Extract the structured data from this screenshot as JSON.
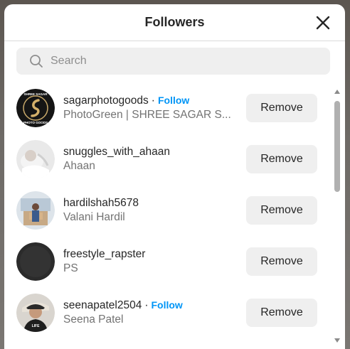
{
  "modal": {
    "title": "Followers"
  },
  "search": {
    "placeholder": "Search"
  },
  "followers": [
    {
      "username": "sagarphotogoods",
      "separator": "·",
      "follow_label": "Follow",
      "full_name": "PhotoGreen | SHREE SAGAR S...",
      "remove_label": "Remove",
      "avatar_text": "SHREE SAGAR PHOTO GOODS"
    },
    {
      "username": "snuggles_with_ahaan",
      "full_name": "Ahaan",
      "remove_label": "Remove"
    },
    {
      "username": "hardilshah5678",
      "full_name": "Valani Hardil",
      "remove_label": "Remove"
    },
    {
      "username": "freestyle_rapster",
      "full_name": "PS",
      "remove_label": "Remove"
    },
    {
      "username": "seenapatel2504",
      "separator": "·",
      "follow_label": "Follow",
      "full_name": "Seena Patel",
      "remove_label": "Remove"
    }
  ],
  "colors": {
    "accent": "#0095f6",
    "button_bg": "#efefef",
    "secondary_text": "#737373"
  }
}
